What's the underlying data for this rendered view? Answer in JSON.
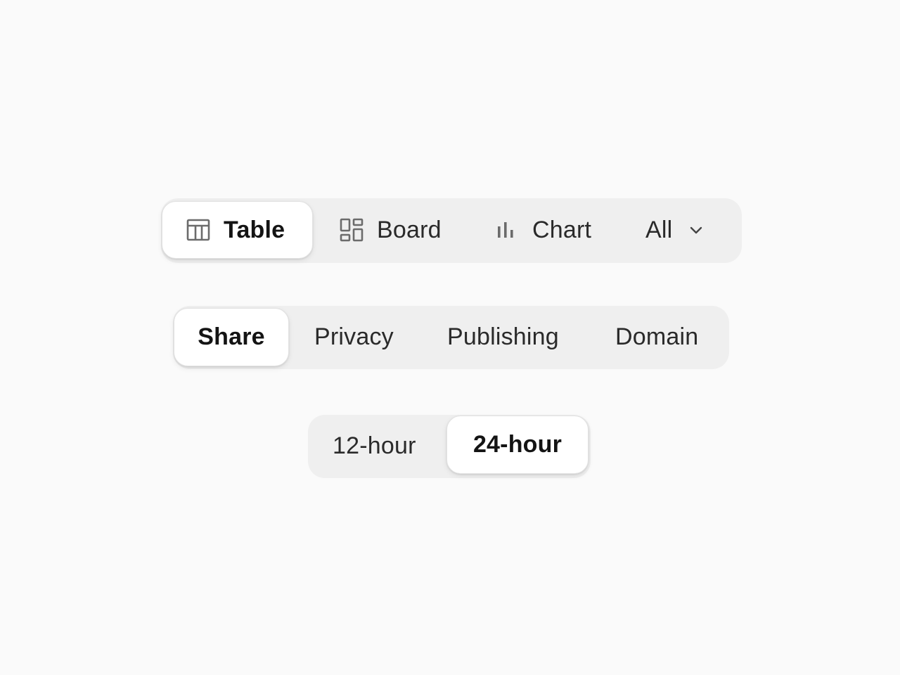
{
  "view_switcher": {
    "items": [
      {
        "label": "Table",
        "icon": "table-icon",
        "active": true
      },
      {
        "label": "Board",
        "icon": "board-icon",
        "active": false
      },
      {
        "label": "Chart",
        "icon": "bar-chart-icon",
        "active": false
      }
    ],
    "filter": {
      "label": "All",
      "icon": "chevron-down-icon"
    }
  },
  "settings_tabs": {
    "items": [
      {
        "label": "Share",
        "active": true
      },
      {
        "label": "Privacy",
        "active": false
      },
      {
        "label": "Publishing",
        "active": false
      },
      {
        "label": "Domain",
        "active": false
      }
    ]
  },
  "time_format": {
    "items": [
      {
        "label": "12-hour",
        "active": false
      },
      {
        "label": "24-hour",
        "active": true
      }
    ]
  },
  "colors": {
    "background": "#fafafa",
    "segment_track": "#efefef",
    "active_pill": "#ffffff",
    "text": "#2a2a2a",
    "icon": "#6b6b6b"
  }
}
